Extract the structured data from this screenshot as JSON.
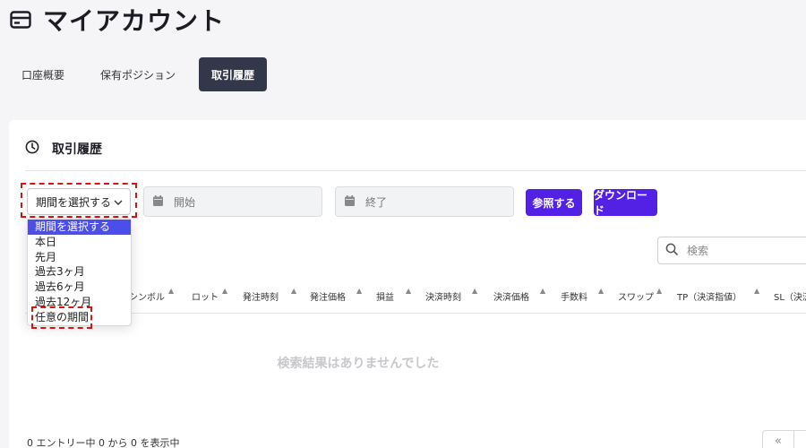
{
  "page": {
    "title": "マイアカウント",
    "icon": "card-icon"
  },
  "tabs": [
    {
      "label": "口座概要",
      "active": false
    },
    {
      "label": "保有ポジション",
      "active": false
    },
    {
      "label": "取引履歴",
      "active": true
    }
  ],
  "panel": {
    "title": "取引履歴",
    "icon": "clock-icon"
  },
  "filters": {
    "period_select_label": "期間を選択する",
    "start_placeholder": "開始",
    "end_placeholder": "終了",
    "reference_button": "参照する",
    "download_button": "ダウンロード"
  },
  "dropdown": {
    "options": [
      "期間を選択する",
      "本日",
      "先月",
      "過去3ヶ月",
      "過去6ヶ月",
      "過去12ヶ月",
      "任意の期間"
    ],
    "highlighted_index": 0
  },
  "search": {
    "placeholder": "検索"
  },
  "table": {
    "columns": [
      "シンボル",
      "ロット",
      "発注時刻",
      "発注価格",
      "損益",
      "決済時刻",
      "決済価格",
      "手数料",
      "スワップ",
      "TP（決済指値）",
      "SL（決済"
    ],
    "empty_message": "検索結果はありませんでした"
  },
  "footer": {
    "entries_text": "0 エントリー中 0 から 0 を表示中",
    "first_page_symbol": "«"
  },
  "colors": {
    "accent": "#5321e6",
    "tab_active": "#33374a",
    "highlight": "#4b4ee8",
    "callout": "#d61515"
  }
}
